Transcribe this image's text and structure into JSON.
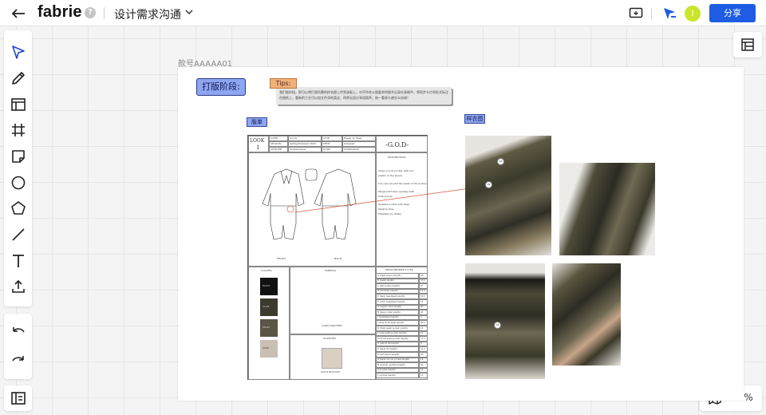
{
  "app": {
    "name": "fabrie",
    "help_label": "?",
    "project_title": "设计需求沟通"
  },
  "header": {
    "share_label": "分享",
    "avatar_initial": "I"
  },
  "colors": {
    "accent": "#1e5ce3",
    "tag_blue": "#8ea5f0",
    "tips_orange": "#f0b07a",
    "avatar": "#cbe52e"
  },
  "toolbar": {
    "tools": [
      "select-icon",
      "pen-icon",
      "table-icon",
      "frame-icon",
      "sticky-note-icon",
      "circle-icon",
      "polygon-icon",
      "line-icon",
      "text-icon",
      "upload-icon"
    ],
    "history": [
      "undo-icon",
      "redo-icon"
    ],
    "bottom": "layers-icon"
  },
  "zoom": {
    "value": "16%"
  },
  "artboard": {
    "label": "款号AAAAA01",
    "stage_tag": "打版阶段:",
    "tips_label": "Tips:",
    "tips_text": "我们版阶段，即可以将打版所需的样衣图上传到该板上，对不符合公版要求的细节记录在表格中，将同步卡片的形式标注在图纸上，重新的工艺可以加文件添的类这，再将无组分享组版师，统一看表与递交么协调！",
    "pattern_tag": "版单",
    "sample_tag": "样衣图"
  },
  "sheet": {
    "look": "LOOK",
    "look_num": "1",
    "meta": [
      [
        "CARD",
        "G.O.D",
        "LINE",
        "Ready To Wear"
      ],
      [
        "SEASON",
        "Spring/Summer 2020",
        "ITEM",
        "Jumpsuit"
      ],
      [
        "GENDER",
        "Womenswear",
        "CODE",
        "GODSS2020"
      ]
    ],
    "brand": "-G.O.D-",
    "description_title": "DESCRIPTION",
    "description_lines": [
      "Cargo pouch pocket with box",
      "pleats on the sleeve.",
      "Cut-outs around the waist of the bodice.",
      "Single buttoned opening with",
      "button-hole.",
      "Seamed pocket with flaps.",
      "Waist bodice.",
      "Finishing by lining."
    ],
    "front_label": "FRONT",
    "back_label": "BACK",
    "colors_title": "COLORS",
    "fabrics_title": "FABRICS",
    "supplies_title": "SUPPLIES",
    "fabric_name": "CAMO PATTERN",
    "supply_name": "GOLD BUTTON",
    "swatches": [
      {
        "name": "BLACK",
        "hex": "#111111"
      },
      {
        "name": "OLIVE",
        "hex": "#3d3b2e"
      },
      {
        "name": "KHAKI",
        "hex": "#5a5646"
      },
      {
        "name": "NUDE",
        "hex": "#c9bfb3"
      }
    ],
    "measurement_title": "MEASUREMENT (CM)",
    "measurements": [
      [
        "A (right sleeve length)",
        "26"
      ],
      [
        "B (pants length)",
        "37.5"
      ],
      [
        "C (full bodice length)",
        "47"
      ],
      [
        "D (shoulder length)",
        "14.2"
      ],
      [
        "E (back waistband length)",
        "33.5"
      ],
      [
        "F (front waistband length)",
        "18"
      ],
      [
        "G (upper collar length)",
        "35"
      ],
      [
        "H (lapel collar length)",
        "25"
      ],
      [
        "I (waistband height)",
        "3"
      ],
      [
        "J (side front seam length)",
        "39.5"
      ],
      [
        "K (front seam pocket length)",
        "18"
      ],
      [
        "L (side seam pocket length)",
        "12"
      ],
      [
        "M (front seam pocket length)",
        "17.5"
      ],
      [
        "N (elbow rib length)",
        "9"
      ],
      [
        "O (back rib length)",
        "13.5"
      ],
      [
        "P (left sleeve length)",
        "26"
      ],
      [
        "Q (back cut-out pocket length)",
        "14"
      ],
      [
        "R (bottom opening length)",
        "35"
      ],
      [
        "S (pocket length)",
        "18"
      ],
      [
        "T (pocket height)",
        "15"
      ]
    ]
  },
  "sample_points": [
    "16",
    "26",
    "31",
    "15"
  ]
}
